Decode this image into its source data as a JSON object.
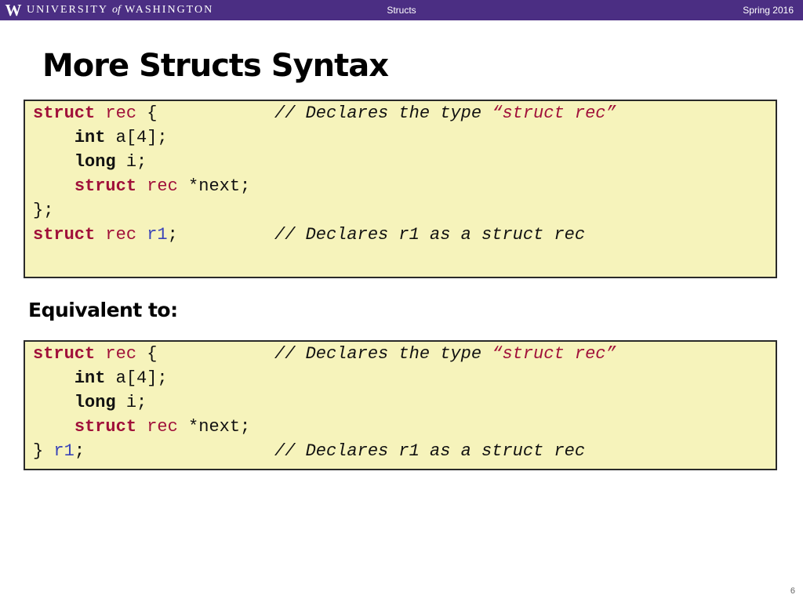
{
  "header": {
    "logo_letter": "W",
    "university_part1": "UNIVERSITY ",
    "university_of": "of",
    "university_part2": " WASHINGTON",
    "topic": "Structs",
    "term": "Spring 2016"
  },
  "slide": {
    "title": "More Structs Syntax",
    "subheading": "Equivalent to:",
    "page_number": "6"
  },
  "code_block_1": {
    "line1": {
      "kw": "struct",
      "tag": " rec",
      "rest": " {",
      "comment_pre": "// Declares the type ",
      "comment_str": "“struct rec”"
    },
    "line2": {
      "indent": "    ",
      "type": "int",
      "rest": " a[4];"
    },
    "line3": {
      "indent": "    ",
      "type": "long",
      "rest": " i;"
    },
    "line4": {
      "indent": "    ",
      "kw": "struct",
      "tag": " rec",
      "rest": " *next;"
    },
    "line5": {
      "rest": "};"
    },
    "line6": {
      "kw": "struct",
      "tag": " rec",
      "var": " r1",
      "rest": ";",
      "comment": "// Declares r1 as a struct rec"
    }
  },
  "code_block_2": {
    "line1": {
      "kw": "struct",
      "tag": " rec",
      "rest": " {",
      "comment_pre": "// Declares the type ",
      "comment_str": "“struct rec”"
    },
    "line2": {
      "indent": "    ",
      "type": "int",
      "rest": " a[4];"
    },
    "line3": {
      "indent": "    ",
      "type": "long",
      "rest": " i;"
    },
    "line4": {
      "indent": "    ",
      "kw": "struct",
      "tag": " rec",
      "rest": " *next;"
    },
    "line5": {
      "rest": "}",
      "var": " r1",
      "rest2": ";",
      "comment": "// Declares r1 as a struct rec"
    }
  },
  "colors": {
    "header_purple": "#4b2e83",
    "keyword_red": "#a0103a",
    "variable_blue": "#3a44b8",
    "code_bg": "#f6f3bb"
  }
}
